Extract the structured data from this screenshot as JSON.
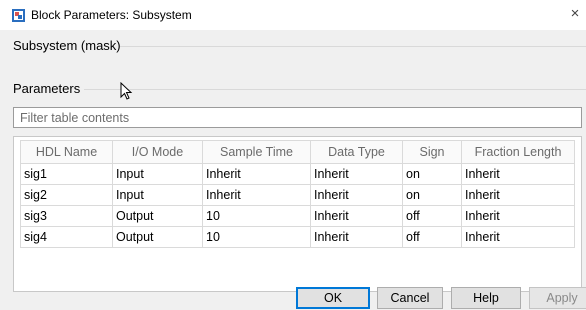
{
  "window": {
    "title": "Block Parameters: Subsystem",
    "close_glyph": "×",
    "icon": "simulink-block-icon"
  },
  "mask": {
    "title": "Subsystem (mask)"
  },
  "parameters": {
    "label": "Parameters",
    "filter_placeholder": "Filter table contents",
    "filter_value": ""
  },
  "table": {
    "columns": [
      "HDL Name",
      "I/O Mode",
      "Sample Time",
      "Data Type",
      "Sign",
      "Fraction Length"
    ],
    "rows": [
      [
        "sig1",
        "Input",
        "Inherit",
        "Inherit",
        "on",
        "Inherit"
      ],
      [
        "sig2",
        "Input",
        "Inherit",
        "Inherit",
        "on",
        "Inherit"
      ],
      [
        "sig3",
        "Output",
        "10",
        "Inherit",
        "off",
        "Inherit"
      ],
      [
        "sig4",
        "Output",
        "10",
        "Inherit",
        "off",
        "Inherit"
      ]
    ]
  },
  "buttons": {
    "ok": "OK",
    "cancel": "Cancel",
    "help": "Help",
    "apply": "Apply"
  },
  "colors": {
    "default_button_border": "#0078d7",
    "dialog_background": "#f0f0f0"
  }
}
